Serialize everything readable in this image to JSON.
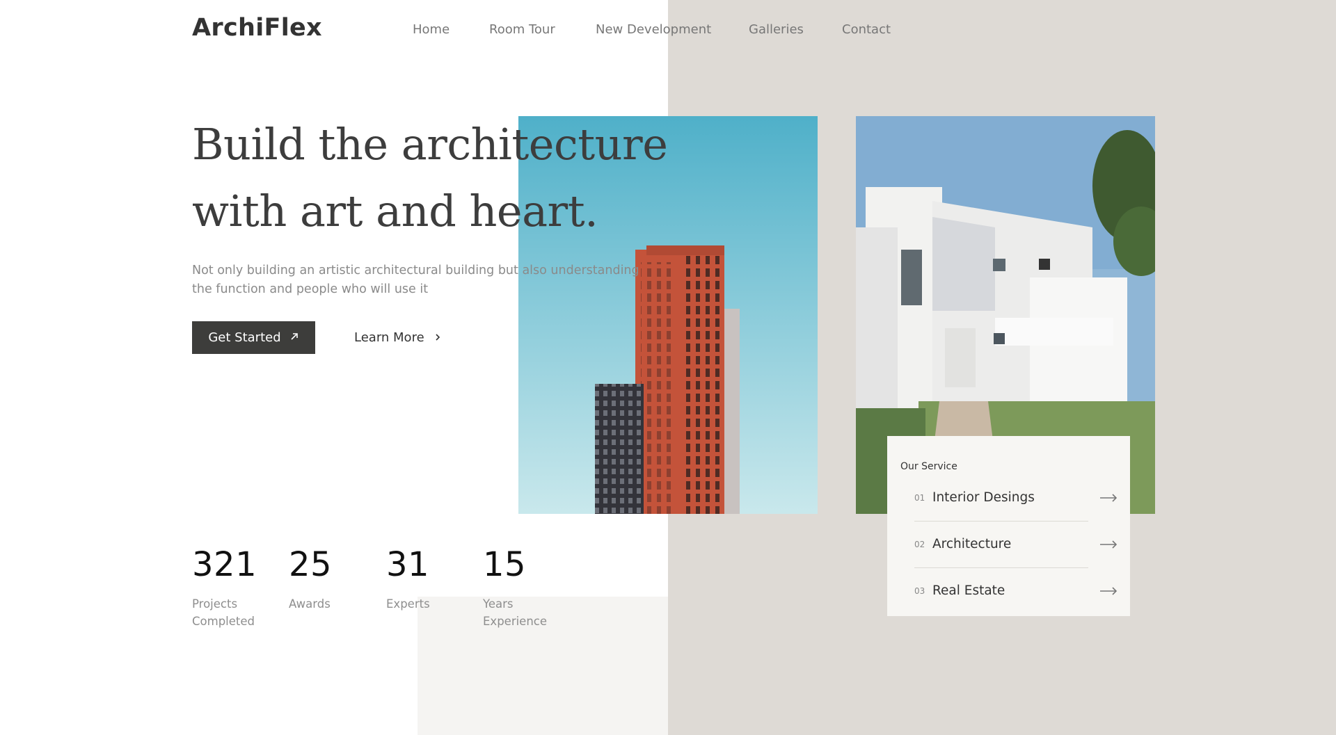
{
  "brand": {
    "name": "ArchiFlex"
  },
  "nav": {
    "items": [
      {
        "label": "Home"
      },
      {
        "label": "Room Tour"
      },
      {
        "label": "New Development"
      },
      {
        "label": "Galleries"
      },
      {
        "label": "Contact"
      }
    ]
  },
  "hero": {
    "headline_line1": "Build the architecture",
    "headline_line2": "with art and heart.",
    "subtitle_line1": "Not only building an artistic architectural building but also understanding",
    "subtitle_line2": "the function and people who will use it",
    "primary_button": "Get Started",
    "secondary_button": "Learn More"
  },
  "stats": [
    {
      "value": "321",
      "label_line1": "Projects",
      "label_line2": "Completed"
    },
    {
      "value": "25",
      "label_line1": "Awards",
      "label_line2": ""
    },
    {
      "value": "31",
      "label_line1": "Experts",
      "label_line2": ""
    },
    {
      "value": "15",
      "label_line1": "Years",
      "label_line2": "Experience"
    }
  ],
  "service": {
    "title": "Our Service",
    "items": [
      {
        "index": "01",
        "name": "Interior Desings"
      },
      {
        "index": "02",
        "name": "Architecture"
      },
      {
        "index": "03",
        "name": "Real Estate"
      }
    ]
  },
  "icons": {
    "primary_button_icon": "arrow-up-right-icon",
    "secondary_button_icon": "chevron-right-icon",
    "service_item_icon": "arrow-right-icon"
  },
  "colors": {
    "background_right": "#dedad5",
    "primary_button": "#3d3d3b",
    "text_dark": "#3d3d3d",
    "text_muted": "#8a8a8a"
  }
}
